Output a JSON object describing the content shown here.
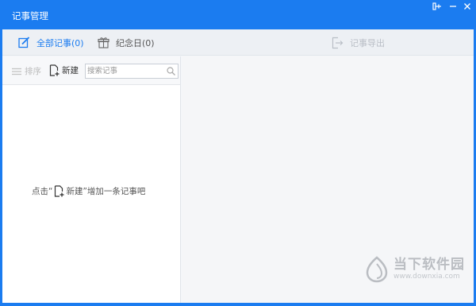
{
  "window": {
    "title": "记事管理"
  },
  "tabs": {
    "all": "全部记事(0)",
    "anniversary": "纪念日(0)",
    "export": "记事导出"
  },
  "toolbar": {
    "sort_label": "排序",
    "new_label": "新建",
    "search_placeholder": "搜索记事"
  },
  "empty_hint": {
    "prefix": "点击“",
    "new_label": "新建",
    "suffix": "”增加一条记事吧"
  },
  "watermark": {
    "name": "当下软件园",
    "url": "www.downxia.com"
  },
  "colors": {
    "titlebar": "#1b7cf0",
    "active_tab": "#1b7cf0",
    "disabled": "#b9bec6"
  },
  "icons": {
    "title_actions": [
      "pin-icon",
      "minimize-icon",
      "close-icon"
    ],
    "tab_all": "edit-icon",
    "tab_anniversary": "gift-icon",
    "tab_export": "export-icon",
    "sort": "sort-lines-icon",
    "new": "new-document-icon",
    "search": "search-icon"
  }
}
